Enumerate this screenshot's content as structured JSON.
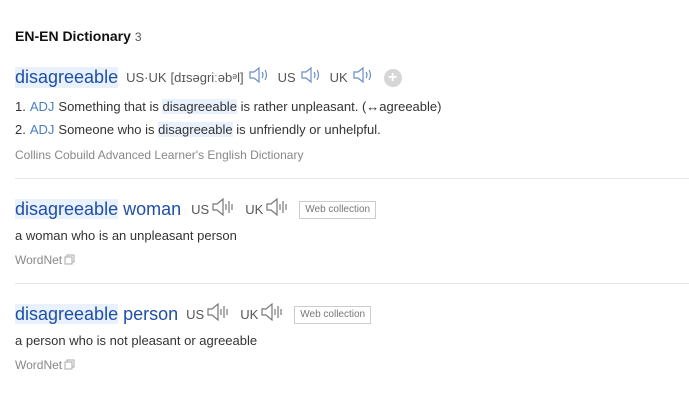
{
  "header": {
    "title": "EN-EN Dictionary",
    "count": "3"
  },
  "entry1": {
    "headword": "disagreeable",
    "phonetic_label": "US·UK",
    "phonetic": "[dɪsəgriːəbᵊl]",
    "us_label": "US",
    "uk_label": "UK",
    "definitions": [
      {
        "num": "1.",
        "pos": "ADJ",
        "pre": "Something that is",
        "hl": "disagreeable",
        "post": "is rather unpleasant. (↔agreeable)"
      },
      {
        "num": "2.",
        "pos": "ADJ",
        "pre": "Someone who is",
        "hl": "disagreeable",
        "post": "is unfriendly or unhelpful."
      }
    ],
    "source": "Collins Cobuild Advanced Learner's English Dictionary"
  },
  "entry2": {
    "headword_hl": "disagreeable",
    "headword_rest": "woman",
    "us_label": "US",
    "uk_label": "UK",
    "web_collection": "Web collection",
    "definition": "a woman who is an unpleasant person",
    "source": "WordNet"
  },
  "entry3": {
    "headword_hl": "disagreeable",
    "headword_rest": "person",
    "us_label": "US",
    "uk_label": "UK",
    "web_collection": "Web collection",
    "definition": "a person who is not pleasant or agreeable",
    "source": "WordNet"
  },
  "icons": {
    "speaker": "speaker-icon",
    "add": "add-icon",
    "copy": "copy-icon"
  }
}
